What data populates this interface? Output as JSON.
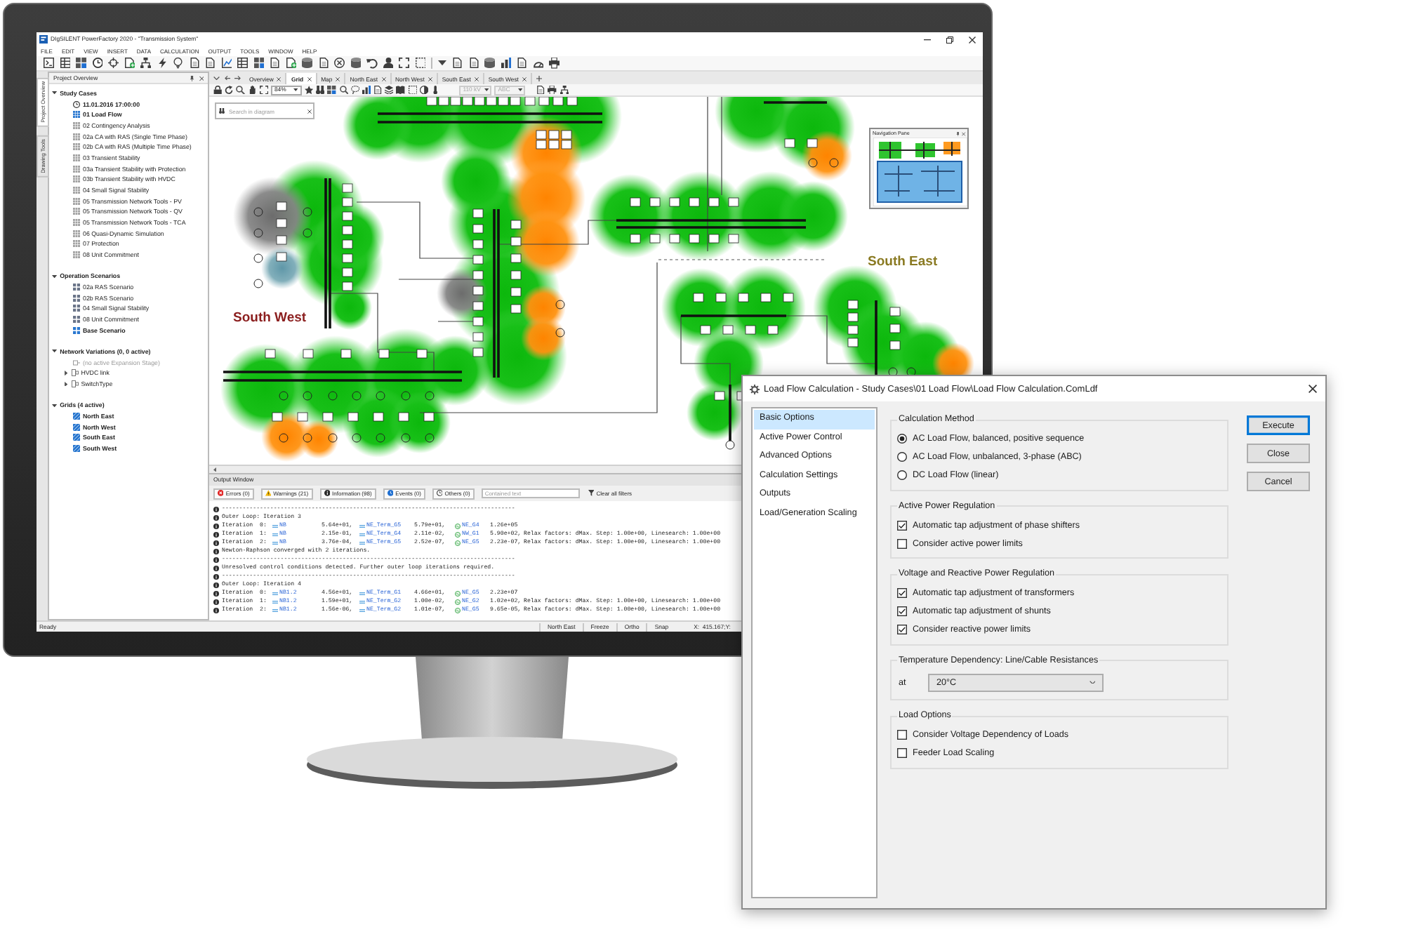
{
  "window": {
    "title": "DIgSILENT PowerFactory 2020 - \"Transmission System\""
  },
  "menu": [
    "FILE",
    "EDIT",
    "VIEW",
    "INSERT",
    "DATA",
    "CALCULATION",
    "OUTPUT",
    "TOOLS",
    "WINDOW",
    "HELP"
  ],
  "side_tabs": [
    {
      "label": "Project Overview",
      "selected": true
    },
    {
      "label": "Drawing Tools",
      "selected": false
    }
  ],
  "project_overview": {
    "title": "Project Overview",
    "tree": [
      {
        "label": "Study Cases",
        "expanded": true,
        "children": [
          {
            "label": "11.01.2016 17:00:00",
            "kind": "time",
            "active": true
          },
          {
            "label": "01 Load Flow",
            "kind": "study_case",
            "active": true
          },
          {
            "label": "02 Contingency Analysis",
            "kind": "study_case",
            "active": false
          },
          {
            "label": "02a CA with RAS (Single Time Phase)",
            "kind": "study_case",
            "active": false
          },
          {
            "label": "02b CA with RAS (Multiple Time Phase)",
            "kind": "study_case",
            "active": false
          },
          {
            "label": "03 Transient Stability",
            "kind": "study_case",
            "active": false
          },
          {
            "label": "03a Transient Stability with Protection",
            "kind": "study_case",
            "active": false
          },
          {
            "label": "03b Transient Stability with HVDC",
            "kind": "study_case",
            "active": false
          },
          {
            "label": "04 Small Signal Stability",
            "kind": "study_case",
            "active": false
          },
          {
            "label": "05 Transmission Network Tools - PV",
            "kind": "study_case",
            "active": false
          },
          {
            "label": "05 Transmission Network Tools - QV",
            "kind": "study_case",
            "active": false
          },
          {
            "label": "05 Transmission Network Tools - TCA",
            "kind": "study_case",
            "active": false
          },
          {
            "label": "06 Quasi-Dynamic Simulation",
            "kind": "study_case",
            "active": false
          },
          {
            "label": "07 Protection",
            "kind": "study_case",
            "active": false
          },
          {
            "label": "08 Unit Commitment",
            "kind": "study_case",
            "active": false
          }
        ]
      },
      {
        "label": "Operation Scenarios",
        "expanded": true,
        "children": [
          {
            "label": "02a RAS Scenario",
            "kind": "scenario",
            "active": false
          },
          {
            "label": "02b RAS Scenario",
            "kind": "scenario",
            "active": false
          },
          {
            "label": "04 Small Signal Stability",
            "kind": "scenario",
            "active": false
          },
          {
            "label": "08 Unit Commitment",
            "kind": "scenario",
            "active": false
          },
          {
            "label": "Base Scenario",
            "kind": "scenario",
            "active": true
          }
        ]
      },
      {
        "label": "Network Variations (0, 0 active)",
        "expanded": true,
        "children": [
          {
            "label": "(no active Expansion Stage)",
            "kind": "stage",
            "active": false,
            "disabled": true
          },
          {
            "label": "HVDC link",
            "kind": "variation",
            "active": false,
            "disabled": false,
            "expanded": false
          },
          {
            "label": "SwitchType",
            "kind": "variation",
            "active": false,
            "disabled": false,
            "expanded": false
          }
        ]
      },
      {
        "label": "Grids (4 active)",
        "expanded": true,
        "children": [
          {
            "label": "North East",
            "kind": "grid",
            "active": true
          },
          {
            "label": "North West",
            "kind": "grid",
            "active": true
          },
          {
            "label": "South East",
            "kind": "grid",
            "active": true
          },
          {
            "label": "South West",
            "kind": "grid",
            "active": true
          }
        ]
      }
    ]
  },
  "diagram_tabs": [
    {
      "label": "Overview",
      "selected": false
    },
    {
      "label": "Grid",
      "selected": true
    },
    {
      "label": "Map",
      "selected": false
    },
    {
      "label": "North East",
      "selected": false
    },
    {
      "label": "North West",
      "selected": false
    },
    {
      "label": "South East",
      "selected": false
    },
    {
      "label": "South West",
      "selected": false
    }
  ],
  "diagram_toolbar": {
    "zoom": "84%",
    "voltage": {
      "value": "110 kV",
      "disabled": true
    },
    "phase": {
      "value": "ABC",
      "disabled": true
    }
  },
  "diagram": {
    "search": {
      "placeholder": "Search in diagram"
    },
    "region_labels": [
      {
        "label": "South West",
        "color": "#8b1e1e"
      },
      {
        "label": "South East",
        "color": "#8a7a22"
      }
    ],
    "navigation_pane": {
      "title": "Navigation Pane"
    }
  },
  "output_window": {
    "title": "Output Window",
    "filters": [
      {
        "kind": "error",
        "label": "Errors (0)"
      },
      {
        "kind": "warning",
        "label": "Warnings (21)"
      },
      {
        "kind": "info",
        "label": "Information (98)"
      },
      {
        "kind": "event",
        "label": "Events (0)"
      },
      {
        "kind": "other",
        "label": "Others (0)"
      }
    ],
    "text_filter": {
      "placeholder": "Contained text"
    },
    "clear_filters": "Clear all filters",
    "lines": [
      {
        "kind": "separator",
        "text": "-------------------------------------------------------------------------------------"
      },
      {
        "kind": "message",
        "text": "Outer Loop: Iteration 3"
      },
      {
        "kind": "iteration",
        "label": "Iteration  0:",
        "bus": "NB",
        "bus_value": "5.64e+01,",
        "terminal": "NE_Term_G5",
        "terminal_value": "5.79e+01,",
        "generator": "NE_G4",
        "generator_value": "1.26e+05"
      },
      {
        "kind": "iteration",
        "label": "Iteration  1:",
        "bus": "NB",
        "bus_value": "2.15e-01,",
        "terminal": "NE_Term_G4",
        "terminal_value": "2.11e-02,",
        "generator": "NW_G1",
        "generator_value": "5.90e+02,",
        "relax": "Relax factors: dMax. Step: 1.00e+00, Linesearch: 1.00e+00"
      },
      {
        "kind": "iteration",
        "label": "Iteration  2:",
        "bus": "NB",
        "bus_value": "3.76e-04,",
        "terminal": "NE_Term_G5",
        "terminal_value": "2.52e-07,",
        "generator": "NE_G5",
        "generator_value": "2.23e-07,",
        "relax": "Relax factors: dMax. Step: 1.00e+00, Linesearch: 1.00e+00"
      },
      {
        "kind": "message",
        "text": "Newton-Raphson converged with 2 iterations."
      },
      {
        "kind": "separator",
        "text": "-------------------------------------------------------------------------------------"
      },
      {
        "kind": "message",
        "text": "Unresolved control conditions detected. Further outer loop iterations required."
      },
      {
        "kind": "separator",
        "text": "-------------------------------------------------------------------------------------"
      },
      {
        "kind": "message",
        "text": "Outer Loop: Iteration 4"
      },
      {
        "kind": "iteration",
        "label": "Iteration  0:",
        "bus": "NB1.2",
        "bus_value": "4.56e+01,",
        "terminal": "NE_Term_G1",
        "terminal_value": "4.66e+01,",
        "generator": "NE_G5",
        "generator_value": "2.23e+07"
      },
      {
        "kind": "iteration",
        "label": "Iteration  1:",
        "bus": "NB1.2",
        "bus_value": "1.59e+01,",
        "terminal": "NE_Term_G2",
        "terminal_value": "1.00e-02,",
        "generator": "NE_G2",
        "generator_value": "1.02e+02,",
        "relax": "Relax factors: dMax. Step: 1.00e+00, Linesearch: 1.00e+00"
      },
      {
        "kind": "iteration",
        "label": "Iteration  2:",
        "bus": "NB1.2",
        "bus_value": "1.56e-06,",
        "terminal": "NE_Term_G2",
        "terminal_value": "1.01e-07,",
        "generator": "NE_G5",
        "generator_value": "9.65e-05,",
        "relax": "Relax factors: dMax. Step: 1.00e+00, Linesearch: 1.00e+00"
      }
    ]
  },
  "status_bar": {
    "message": "Ready",
    "cells": [
      "North East",
      "Freeze",
      "Ortho",
      "Snap",
      "X:  415.167;Y:"
    ]
  },
  "dialog": {
    "title": "Load Flow Calculation - Study Cases\\01 Load Flow\\Load Flow Calculation.ComLdf",
    "pages": [
      {
        "label": "Basic Options",
        "selected": true
      },
      {
        "label": "Active Power Control",
        "selected": false
      },
      {
        "label": "Advanced Options",
        "selected": false
      },
      {
        "label": "Calculation Settings",
        "selected": false
      },
      {
        "label": "Outputs",
        "selected": false
      },
      {
        "label": "Load/Generation Scaling",
        "selected": false
      }
    ],
    "groups": [
      {
        "title": "Calculation Method",
        "options": [
          {
            "kind": "radio",
            "label": "AC Load Flow, balanced, positive sequence",
            "selected": true
          },
          {
            "kind": "radio",
            "label": "AC Load Flow, unbalanced, 3-phase (ABC)",
            "selected": false
          },
          {
            "kind": "radio",
            "label": "DC Load Flow (linear)",
            "selected": false
          }
        ]
      },
      {
        "title": "Active Power Regulation",
        "options": [
          {
            "kind": "checkbox",
            "label": "Automatic tap adjustment of phase shifters",
            "checked": true
          },
          {
            "kind": "checkbox",
            "label": "Consider active power limits",
            "checked": false
          }
        ]
      },
      {
        "title": "Voltage and Reactive Power Regulation",
        "options": [
          {
            "kind": "checkbox",
            "label": "Automatic tap adjustment of transformers",
            "checked": true
          },
          {
            "kind": "checkbox",
            "label": "Automatic tap adjustment of shunts",
            "checked": true
          },
          {
            "kind": "checkbox",
            "label": "Consider reactive power limits",
            "checked": true
          }
        ]
      },
      {
        "title": "Temperature Dependency: Line/Cable Resistances",
        "options": [
          {
            "kind": "dropdown",
            "label": "at",
            "value": "20°C"
          }
        ]
      },
      {
        "title": "Load Options",
        "options": [
          {
            "kind": "checkbox",
            "label": "Consider Voltage Dependency of Loads",
            "checked": false
          },
          {
            "kind": "checkbox",
            "label": "Feeder Load Scaling",
            "checked": false
          }
        ]
      }
    ],
    "buttons": [
      {
        "label": "Execute",
        "default": true
      },
      {
        "label": "Close",
        "default": false
      },
      {
        "label": "Cancel",
        "default": false
      }
    ]
  }
}
